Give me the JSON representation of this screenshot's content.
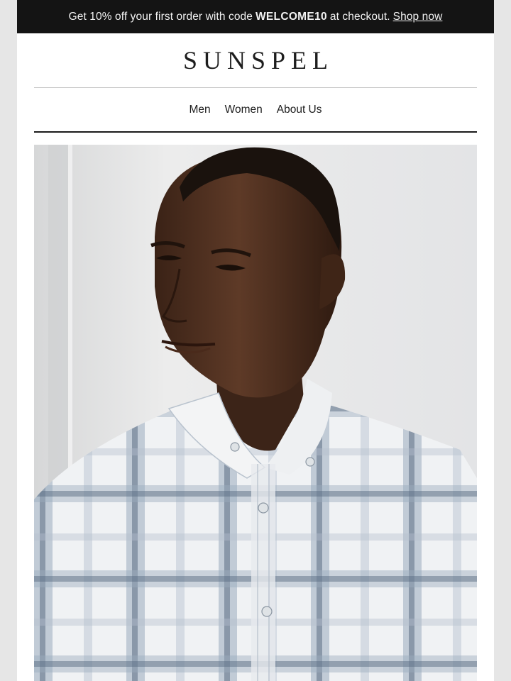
{
  "promo": {
    "text": "Get 10% off your first order with code",
    "code": "WELCOME10",
    "suffix": "at checkout.",
    "link_label": "Shop now"
  },
  "brand": {
    "logo_text": "SUNSPEL"
  },
  "nav": {
    "items": [
      {
        "label": "Men"
      },
      {
        "label": "Women"
      },
      {
        "label": "About Us"
      }
    ]
  },
  "hero": {
    "image": "model-in-blue-check-shirt"
  },
  "colors": {
    "promo_bg": "#141414",
    "page_bg": "#e6e6e6",
    "text": "#1d1d1d"
  }
}
